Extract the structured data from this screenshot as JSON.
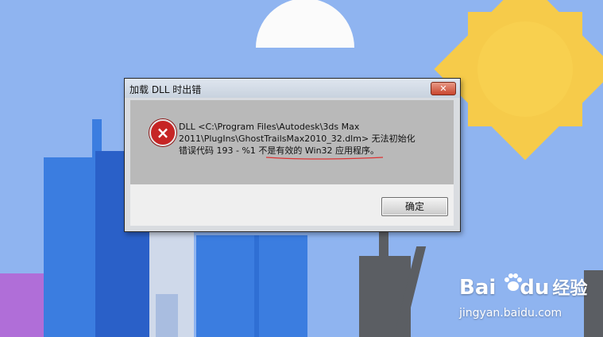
{
  "dialog": {
    "title": "加载 DLL 时出错",
    "close_label": "✕",
    "message_line1": "DLL <C:\\Program Files\\Autodesk\\3ds Max",
    "message_line2": "2011\\PlugIns\\GhostTrailsMax2010_32.dlm> 无法初始化",
    "message_line3": "错误代码 193 - %1 不是有效的 Win32 应用程序。",
    "ok_label": "确定"
  },
  "icons": {
    "error": "error-icon",
    "close": "close-icon"
  },
  "watermark": {
    "brand_a": "Bai",
    "brand_b": "du",
    "brand_cn": "经验",
    "url": "jingyan.baidu.com"
  },
  "colors": {
    "sky": "#8fb4f0",
    "sun": "#f6cb4a",
    "building_blue": "#3b7de0",
    "building_dark": "#2a60c8",
    "building_light": "#cfd9ea",
    "tower_gray": "#5b5e63",
    "purple": "#b06ed8"
  }
}
